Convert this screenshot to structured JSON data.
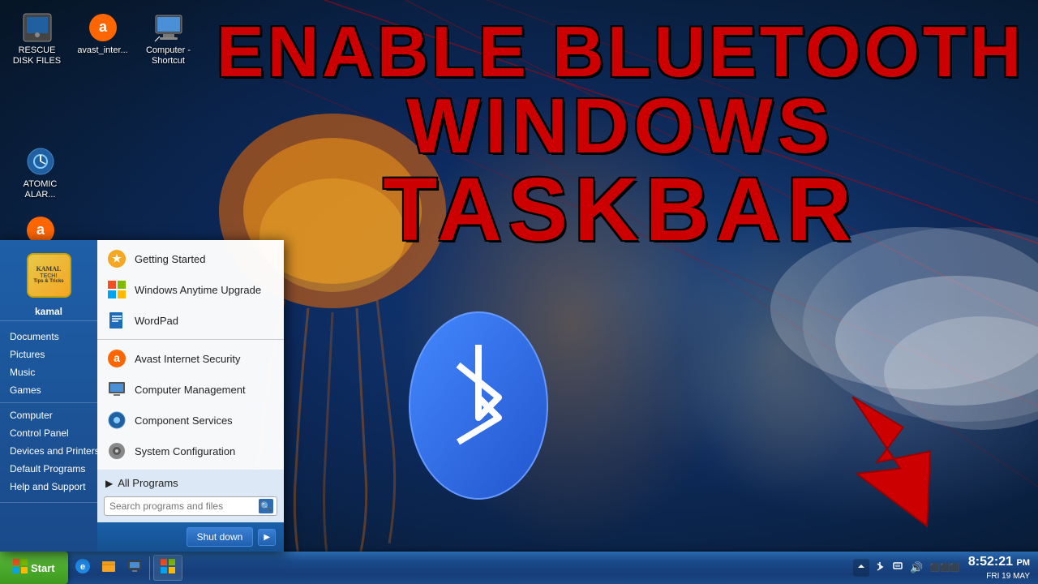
{
  "desktop": {
    "background_color": "#0d2a5a"
  },
  "title_overlay": {
    "line1": "ENABLE BLUETOOTH",
    "line2": "WINDOWS",
    "line3": "TASKBAR"
  },
  "desktop_icons": [
    {
      "id": "rescue-disk",
      "label": "RESCUE DISK FILES",
      "icon": "💾"
    },
    {
      "id": "avast-internet",
      "label": "avast_inter...",
      "icon": "🛡️"
    },
    {
      "id": "computer-shortcut",
      "label": "Computer - Shortcut",
      "icon": "🖥️"
    },
    {
      "id": "atomic-alarm",
      "label": "ATOMIC ALAR...",
      "icon": "⏰"
    },
    {
      "id": "avast-desktop",
      "label": "",
      "icon": "🛡️"
    }
  ],
  "start_menu": {
    "visible": true,
    "user": {
      "name": "kamal",
      "avatar_text": "KAMAL\nTECH!"
    },
    "right_links": [
      {
        "id": "documents",
        "label": "Documents"
      },
      {
        "id": "pictures",
        "label": "Pictures"
      },
      {
        "id": "music",
        "label": "Music"
      },
      {
        "id": "games",
        "label": "Games"
      },
      {
        "id": "computer",
        "label": "Computer"
      },
      {
        "id": "control-panel",
        "label": "Control Panel"
      },
      {
        "id": "devices-printers",
        "label": "Devices and Printers"
      },
      {
        "id": "default-programs",
        "label": "Default Programs"
      },
      {
        "id": "help-support",
        "label": "Help and Support"
      }
    ],
    "left_items": [
      {
        "id": "getting-started",
        "label": "Getting Started",
        "icon": "⭐"
      },
      {
        "id": "windows-upgrade",
        "label": "Windows Anytime Upgrade",
        "icon": "🪟"
      },
      {
        "id": "wordpad",
        "label": "WordPad",
        "icon": "📝"
      },
      {
        "id": "avast-security",
        "label": "Avast Internet Security",
        "icon": "🛡️"
      },
      {
        "id": "computer-mgmt",
        "label": "Computer Management",
        "icon": "🖥️"
      },
      {
        "id": "component-services",
        "label": "Component Services",
        "icon": "⚙️"
      },
      {
        "id": "system-config",
        "label": "System Configuration",
        "icon": "🔧"
      }
    ],
    "all_programs_label": "All Programs",
    "search_placeholder": "Search programs and files",
    "shutdown_label": "Shut down"
  },
  "taskbar": {
    "start_label": "Start",
    "apps": [
      {
        "id": "media-player",
        "label": "",
        "icon": "▶️"
      },
      {
        "id": "ie",
        "label": "",
        "icon": "🌐"
      },
      {
        "id": "explorer",
        "label": "",
        "icon": "📁"
      },
      {
        "id": "start-btn",
        "label": "",
        "icon": "🪟"
      },
      {
        "id": "network",
        "label": "",
        "icon": "🖥️"
      }
    ],
    "tray": {
      "icons": [
        "🔊",
        "📶",
        "🖥️"
      ],
      "time": "8:52:21",
      "date_prefix": "FRI",
      "date_day": "19",
      "date_month": "MAY",
      "am_pm": "PM"
    }
  }
}
